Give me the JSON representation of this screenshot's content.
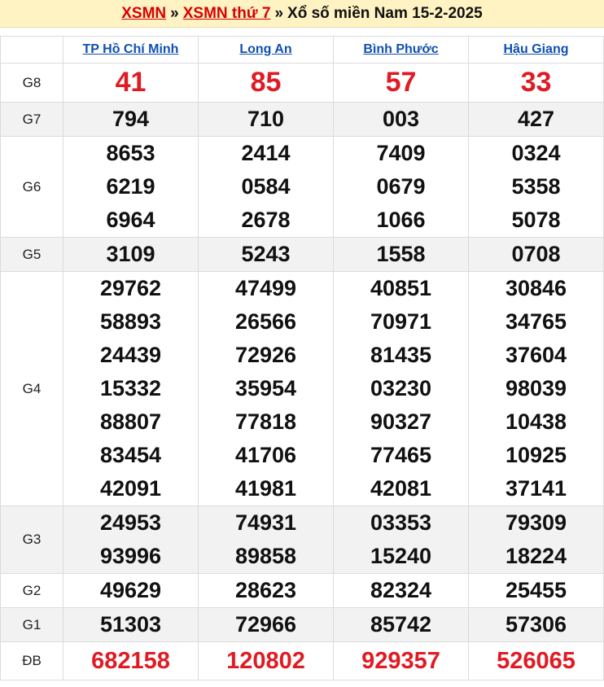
{
  "header": {
    "link1": "XSMN",
    "link2": "XSMN thứ 7",
    "separator": "»",
    "title": "Xổ số miền Nam 15-2-2025"
  },
  "provinces": [
    "TP Hồ Chí Minh",
    "Long An",
    "Bình Phước",
    "Hậu Giang"
  ],
  "prizes": [
    {
      "label": "G8",
      "numbers": [
        [
          "41"
        ],
        [
          "85"
        ],
        [
          "57"
        ],
        [
          "33"
        ]
      ]
    },
    {
      "label": "G7",
      "numbers": [
        [
          "794"
        ],
        [
          "710"
        ],
        [
          "003"
        ],
        [
          "427"
        ]
      ]
    },
    {
      "label": "G6",
      "numbers": [
        [
          "8653",
          "6219",
          "6964"
        ],
        [
          "2414",
          "0584",
          "2678"
        ],
        [
          "7409",
          "0679",
          "1066"
        ],
        [
          "0324",
          "5358",
          "5078"
        ]
      ]
    },
    {
      "label": "G5",
      "numbers": [
        [
          "3109"
        ],
        [
          "5243"
        ],
        [
          "1558"
        ],
        [
          "0708"
        ]
      ]
    },
    {
      "label": "G4",
      "numbers": [
        [
          "29762",
          "58893",
          "24439",
          "15332",
          "88807",
          "83454",
          "42091"
        ],
        [
          "47499",
          "26566",
          "72926",
          "35954",
          "77818",
          "41706",
          "41981"
        ],
        [
          "40851",
          "70971",
          "81435",
          "03230",
          "90327",
          "77465",
          "42081"
        ],
        [
          "30846",
          "34765",
          "37604",
          "98039",
          "10438",
          "10925",
          "37141"
        ]
      ]
    },
    {
      "label": "G3",
      "numbers": [
        [
          "24953",
          "93996"
        ],
        [
          "74931",
          "89858"
        ],
        [
          "03353",
          "15240"
        ],
        [
          "79309",
          "18224"
        ]
      ]
    },
    {
      "label": "G2",
      "numbers": [
        [
          "49629"
        ],
        [
          "28623"
        ],
        [
          "82324"
        ],
        [
          "25455"
        ]
      ]
    },
    {
      "label": "G1",
      "numbers": [
        [
          "51303"
        ],
        [
          "72966"
        ],
        [
          "85742"
        ],
        [
          "57306"
        ]
      ]
    },
    {
      "label": "ĐB",
      "numbers": [
        [
          "682158"
        ],
        [
          "120802"
        ],
        [
          "929357"
        ],
        [
          "526065"
        ]
      ]
    }
  ]
}
